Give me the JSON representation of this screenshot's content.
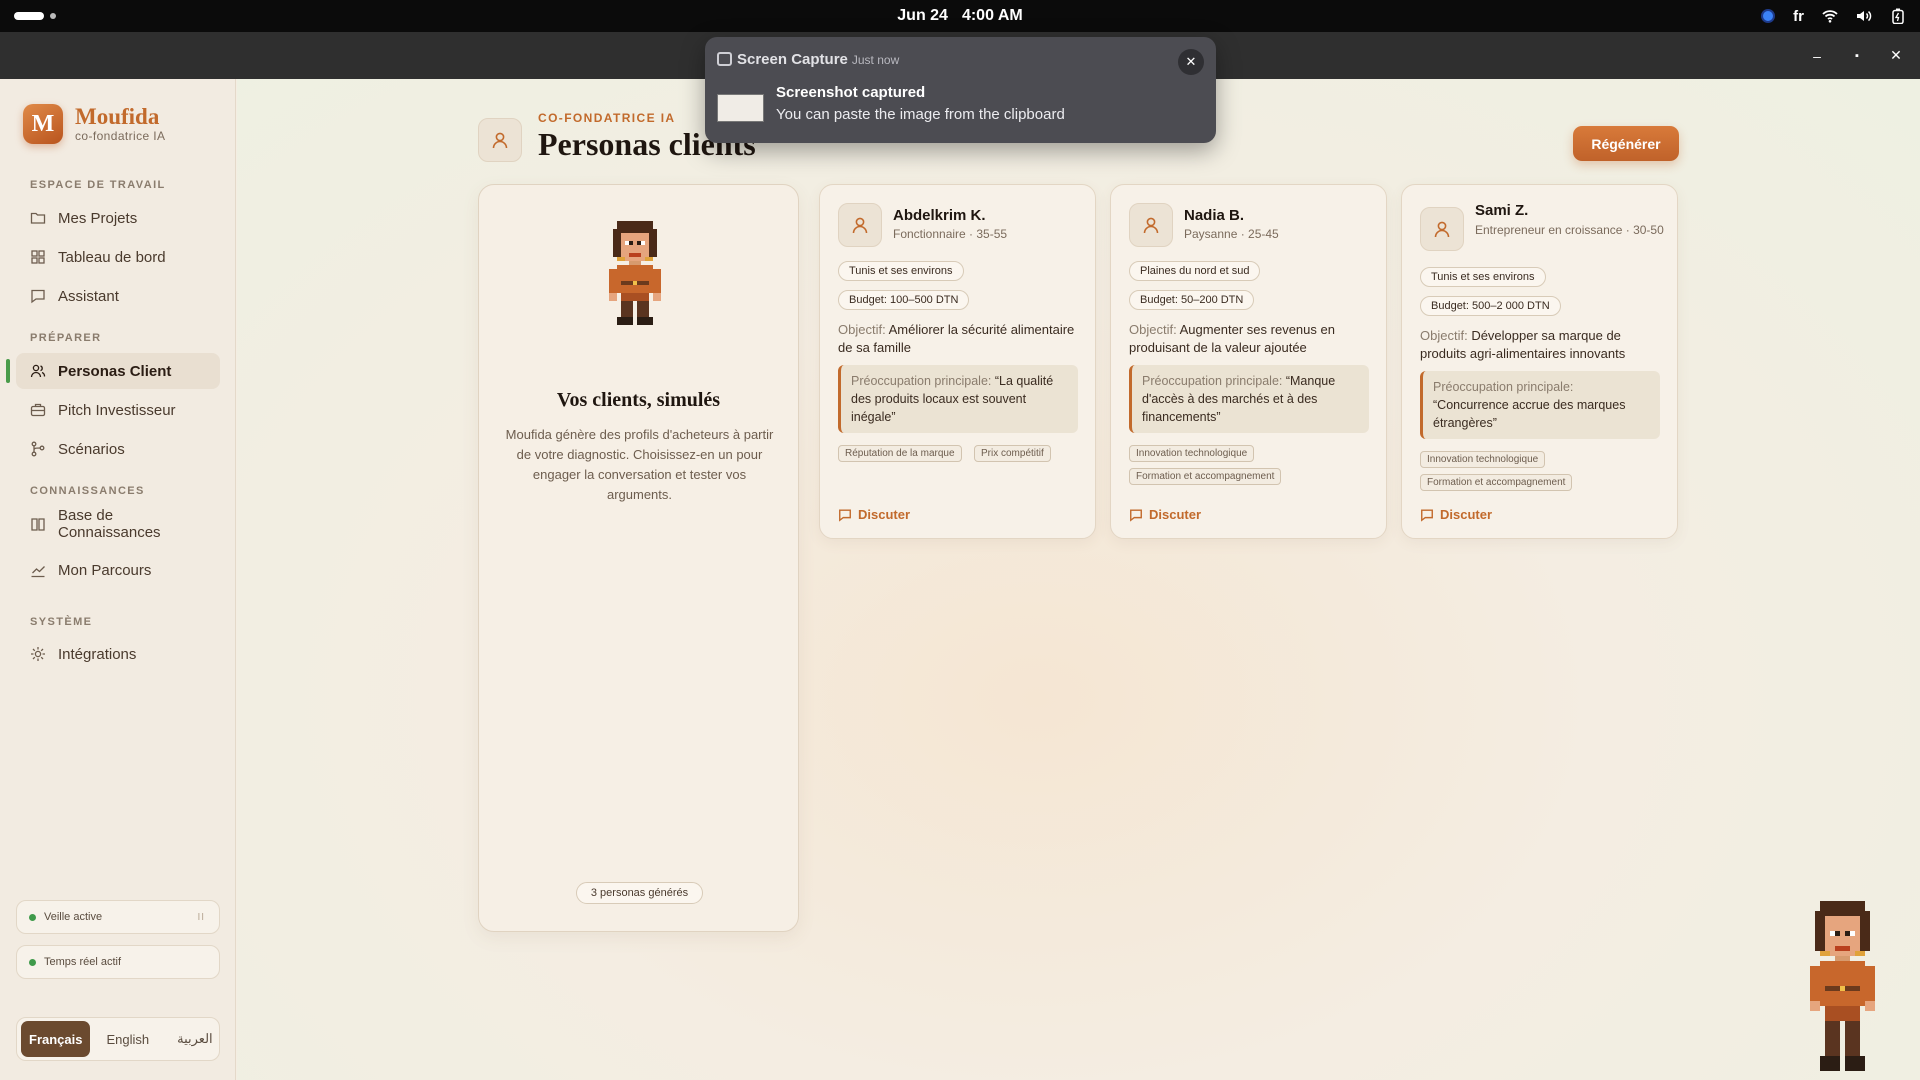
{
  "system": {
    "date": "Jun 24",
    "time": "4:00 AM",
    "lang": "fr"
  },
  "window": {
    "minimize": "–",
    "maximize": "▪",
    "close": "✕"
  },
  "toast": {
    "app": "Screen Capture",
    "when": "Just now",
    "title": "Screenshot captured",
    "body": "You can paste the image from the clipboard",
    "close": "✕"
  },
  "brand": {
    "initial": "M",
    "name": "Moufida",
    "subtitle": "co-fondatrice IA"
  },
  "sidebar": {
    "workspace_label": "ESPACE DE TRAVAIL",
    "workspace": [
      {
        "label": "Mes Projets"
      },
      {
        "label": "Tableau de bord"
      },
      {
        "label": "Assistant"
      }
    ],
    "prepare_label": "PRÉPARER",
    "prepare": [
      {
        "label": "Personas Client"
      },
      {
        "label": "Pitch Investisseur"
      },
      {
        "label": "Scénarios"
      }
    ],
    "knowledge_label": "CONNAISSANCES",
    "knowledge": [
      {
        "label": "Base de Connaissances"
      },
      {
        "label": "Mon Parcours"
      }
    ],
    "system_label": "SYSTÈME",
    "system": [
      {
        "label": "Intégrations"
      }
    ],
    "status": [
      {
        "label": "Veille active",
        "pause": "II"
      },
      {
        "label": "Temps réel actif"
      }
    ],
    "languages": [
      "Français",
      "English",
      "العربية"
    ],
    "selected_language": "Français"
  },
  "page": {
    "eyebrow": "CO-FONDATRICE IA",
    "title": "Personas clients",
    "regenerate": "Régénérer"
  },
  "hero": {
    "title": "Vos clients, simulés",
    "description": "Moufida génère des profils d'acheteurs à partir de votre diagnostic. Choisissez-en un pour engager la conversation et tester vos arguments.",
    "count": "3 personas générés"
  },
  "personas": [
    {
      "name": "Abdelkrim K.",
      "role": "Fonctionnaire · 35-55",
      "location": "Tunis et ses environs",
      "budget": "Budget: 100–500 DTN",
      "objective_label": "Objectif:",
      "objective": "Améliorer la sécurité alimentaire de sa famille",
      "concern_label": "Préoccupation principale:",
      "concern": "“La qualité des produits locaux est souvent inégale”",
      "motivations": [
        "Réputation de la marque",
        "Prix compétitif"
      ],
      "action": "Discuter"
    },
    {
      "name": "Nadia B.",
      "role": "Paysanne · 25-45",
      "location": "Plaines du nord et sud",
      "budget": "Budget: 50–200 DTN",
      "objective_label": "Objectif:",
      "objective": "Augmenter ses revenus en produisant de la valeur ajoutée",
      "concern_label": "Préoccupation principale:",
      "concern": "“Manque d'accès à des marchés et à des financements”",
      "motivations": [
        "Innovation technologique",
        "Formation et accompagnement"
      ],
      "action": "Discuter"
    },
    {
      "name": "Sami Z.",
      "role": "Entrepreneur en croissance · 30-50",
      "location": "Tunis et ses environs",
      "budget": "Budget: 500–2 000 DTN",
      "objective_label": "Objectif:",
      "objective": "Développer sa marque de produits agri-alimentaires innovants",
      "concern_label": "Préoccupation principale:",
      "concern": "“Concurrence accrue des marques étrangères”",
      "motivations": [
        "Innovation technologique",
        "Formation et accompagnement"
      ],
      "action": "Discuter"
    }
  ],
  "colors": {
    "accent": "#c26a2c",
    "sidebar_bg": "#f2ebe1",
    "active_indicator": "#4a9b4a",
    "toast_bg": "#4c4c52"
  }
}
